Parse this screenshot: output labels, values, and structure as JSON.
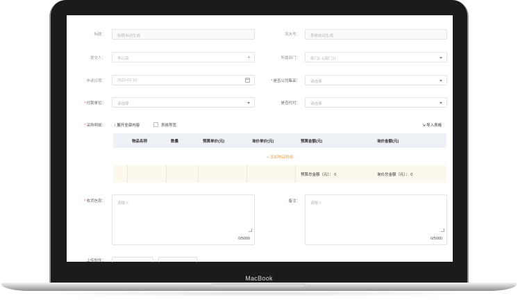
{
  "device_label": "MacBook",
  "form": {
    "title": {
      "label": "标题：",
      "placeholder": "标题自动生成"
    },
    "serial": {
      "label": "流水号：",
      "placeholder": "系统自动生成"
    },
    "submitter": {
      "label": "提交人：",
      "value": "李兴亮",
      "icon": "plus-icon"
    },
    "department": {
      "label": "所属部门：",
      "value": "部门1-1(部门1)"
    },
    "apply_date": {
      "label": "申请日期：",
      "value": "2022-03-10"
    },
    "company_purchase": {
      "label": "是否公司集采：",
      "placeholder": "请选择"
    },
    "payer": {
      "label": "付款单位：",
      "placeholder": "请选择"
    },
    "agent_pay": {
      "label": "是否代付：",
      "placeholder": "请选择"
    },
    "purchase_detail": {
      "label": "采购明细：",
      "expand_label": "展开全部内容",
      "equal_width_label": "表格等宽",
      "import_label": "导入表格",
      "columns": [
        "物品名称",
        "数量",
        "预算单价(元)",
        "询价单价(元)",
        "预算金额(元)",
        "询价金额(元)"
      ],
      "add_label": "添加物品明细",
      "budget_total": "预算总金额（元）： 0",
      "inquiry_total": "询价总金额（元）： 0"
    },
    "receipt_info": {
      "label": "收货信息：",
      "placeholder": "请输入",
      "counter": "0/5000"
    },
    "remark": {
      "label": "备注：",
      "placeholder": "请输入",
      "counter": "0/5000"
    },
    "attachment": {
      "label": "上传附件："
    }
  }
}
